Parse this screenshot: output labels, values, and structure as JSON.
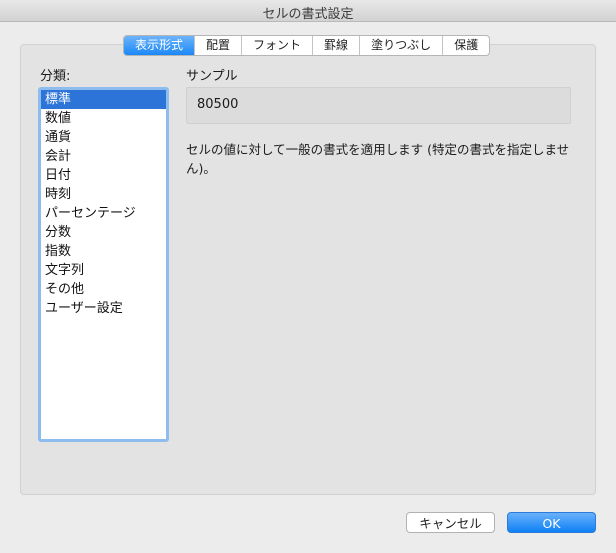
{
  "window": {
    "title": "セルの書式設定"
  },
  "tabs": [
    {
      "label": "表示形式",
      "active": true
    },
    {
      "label": "配置",
      "active": false
    },
    {
      "label": "フォント",
      "active": false
    },
    {
      "label": "罫線",
      "active": false
    },
    {
      "label": "塗りつぶし",
      "active": false
    },
    {
      "label": "保護",
      "active": false
    }
  ],
  "category": {
    "label": "分類:",
    "selected": "標準",
    "items": [
      "標準",
      "数値",
      "通貨",
      "会計",
      "日付",
      "時刻",
      "パーセンテージ",
      "分数",
      "指数",
      "文字列",
      "その他",
      "ユーザー設定"
    ]
  },
  "sample": {
    "label": "サンプル",
    "value": "80500"
  },
  "description": "セルの値に対して一般の書式を適用します (特定の書式を指定しません)。",
  "buttons": {
    "cancel": "キャンセル",
    "ok": "OK"
  },
  "colors": {
    "accent": "#1b88f6",
    "selection": "#2d74d8",
    "focus_ring": "#8fbcef"
  }
}
